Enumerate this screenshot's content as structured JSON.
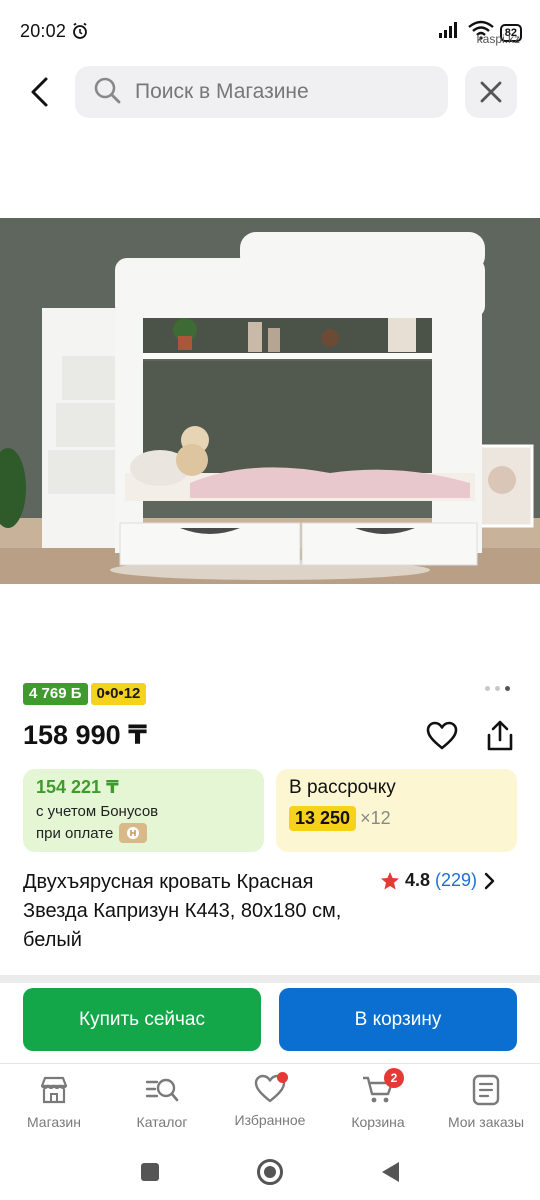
{
  "status_bar": {
    "time": "20:02",
    "battery": "82",
    "watermark": "kaspi.kz"
  },
  "search": {
    "placeholder": "Поиск в Магазине"
  },
  "product": {
    "bonus_badge": "4 769 Б",
    "installment_badge": "0•0•12",
    "price": "158 990 ₸",
    "bonus_price": "154 221 ₸",
    "bonus_line1": "с учетом Бонусов",
    "bonus_line2": "при оплате",
    "installment_title": "В рассрочку",
    "installment_monthly": "13 250",
    "installment_multiplier": "×12",
    "title": "Двухъярусная кровать Красная Звезда Капризун К443, 80х180 см, белый",
    "rating": "4.8",
    "reviews": "(229)"
  },
  "actions": {
    "buy_now": "Купить сейчас",
    "add_to_cart": "В корзину"
  },
  "bottom_nav": {
    "items": [
      {
        "label": "Магазин",
        "icon": "store-icon"
      },
      {
        "label": "Каталог",
        "icon": "catalog-search-icon"
      },
      {
        "label": "Избранное",
        "icon": "heart-icon"
      },
      {
        "label": "Корзина",
        "icon": "cart-icon",
        "badge": "2"
      },
      {
        "label": "Мои заказы",
        "icon": "orders-icon"
      }
    ]
  },
  "colors": {
    "green": "#13a74a",
    "blue": "#0b6fd1",
    "yellow": "#f7d21b",
    "bonus_green": "#3f9b2e",
    "red": "#e53935"
  }
}
